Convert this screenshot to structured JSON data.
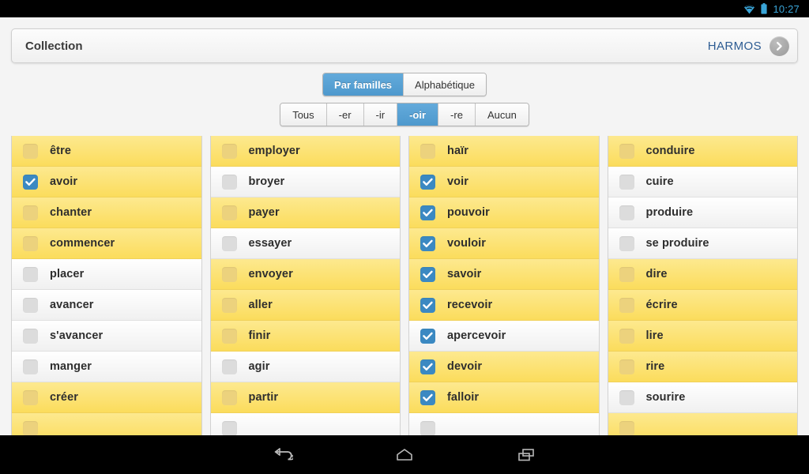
{
  "statusbar": {
    "time": "10:27",
    "wifi_icon": "wifi-icon",
    "battery_icon": "battery-icon",
    "accent_color": "#3aa5d8"
  },
  "header": {
    "title": "Collection",
    "action_label": "HARMOS",
    "chevron_icon": "chevron-right-icon"
  },
  "view_tabs": [
    {
      "label": "Par familles",
      "selected": true
    },
    {
      "label": "Alphabétique",
      "selected": false
    }
  ],
  "filters": [
    {
      "label": "Tous",
      "selected": false
    },
    {
      "label": "-er",
      "selected": false
    },
    {
      "label": "-ir",
      "selected": false
    },
    {
      "label": "-oir",
      "selected": true
    },
    {
      "label": "-re",
      "selected": false
    },
    {
      "label": "Aucun",
      "selected": false
    }
  ],
  "accent_color": "#4e99cd",
  "highlight_color": "#fbdc5c",
  "columns": [
    {
      "items": [
        {
          "label": "être",
          "highlighted": true,
          "checked": false
        },
        {
          "label": "avoir",
          "highlighted": true,
          "checked": true
        },
        {
          "label": "chanter",
          "highlighted": true,
          "checked": false
        },
        {
          "label": "commencer",
          "highlighted": true,
          "checked": false
        },
        {
          "label": "placer",
          "highlighted": false,
          "checked": false
        },
        {
          "label": "avancer",
          "highlighted": false,
          "checked": false
        },
        {
          "label": "s'avancer",
          "highlighted": false,
          "checked": false
        },
        {
          "label": "manger",
          "highlighted": false,
          "checked": false
        },
        {
          "label": "créer",
          "highlighted": true,
          "checked": false
        },
        {
          "label": "",
          "highlighted": true,
          "checked": false
        }
      ]
    },
    {
      "items": [
        {
          "label": "employer",
          "highlighted": true,
          "checked": false
        },
        {
          "label": "broyer",
          "highlighted": false,
          "checked": false
        },
        {
          "label": "payer",
          "highlighted": true,
          "checked": false
        },
        {
          "label": "essayer",
          "highlighted": false,
          "checked": false
        },
        {
          "label": "envoyer",
          "highlighted": true,
          "checked": false
        },
        {
          "label": "aller",
          "highlighted": true,
          "checked": false
        },
        {
          "label": "finir",
          "highlighted": true,
          "checked": false
        },
        {
          "label": "agir",
          "highlighted": false,
          "checked": false
        },
        {
          "label": "partir",
          "highlighted": true,
          "checked": false
        },
        {
          "label": "",
          "highlighted": false,
          "checked": false
        }
      ]
    },
    {
      "items": [
        {
          "label": "haïr",
          "highlighted": true,
          "checked": false
        },
        {
          "label": "voir",
          "highlighted": true,
          "checked": true
        },
        {
          "label": "pouvoir",
          "highlighted": true,
          "checked": true
        },
        {
          "label": "vouloir",
          "highlighted": true,
          "checked": true
        },
        {
          "label": "savoir",
          "highlighted": true,
          "checked": true
        },
        {
          "label": "recevoir",
          "highlighted": true,
          "checked": true
        },
        {
          "label": "apercevoir",
          "highlighted": false,
          "checked": true
        },
        {
          "label": "devoir",
          "highlighted": true,
          "checked": true
        },
        {
          "label": "falloir",
          "highlighted": true,
          "checked": true
        },
        {
          "label": "",
          "highlighted": false,
          "checked": false
        }
      ]
    },
    {
      "items": [
        {
          "label": "conduire",
          "highlighted": true,
          "checked": false
        },
        {
          "label": "cuire",
          "highlighted": false,
          "checked": false
        },
        {
          "label": "produire",
          "highlighted": false,
          "checked": false
        },
        {
          "label": "se produire",
          "highlighted": false,
          "checked": false
        },
        {
          "label": "dire",
          "highlighted": true,
          "checked": false
        },
        {
          "label": "écrire",
          "highlighted": true,
          "checked": false
        },
        {
          "label": "lire",
          "highlighted": true,
          "checked": false
        },
        {
          "label": "rire",
          "highlighted": true,
          "checked": false
        },
        {
          "label": "sourire",
          "highlighted": false,
          "checked": false
        },
        {
          "label": "",
          "highlighted": true,
          "checked": false
        }
      ]
    }
  ],
  "navbar": [
    {
      "icon": "back-icon"
    },
    {
      "icon": "home-icon"
    },
    {
      "icon": "recents-icon"
    }
  ]
}
